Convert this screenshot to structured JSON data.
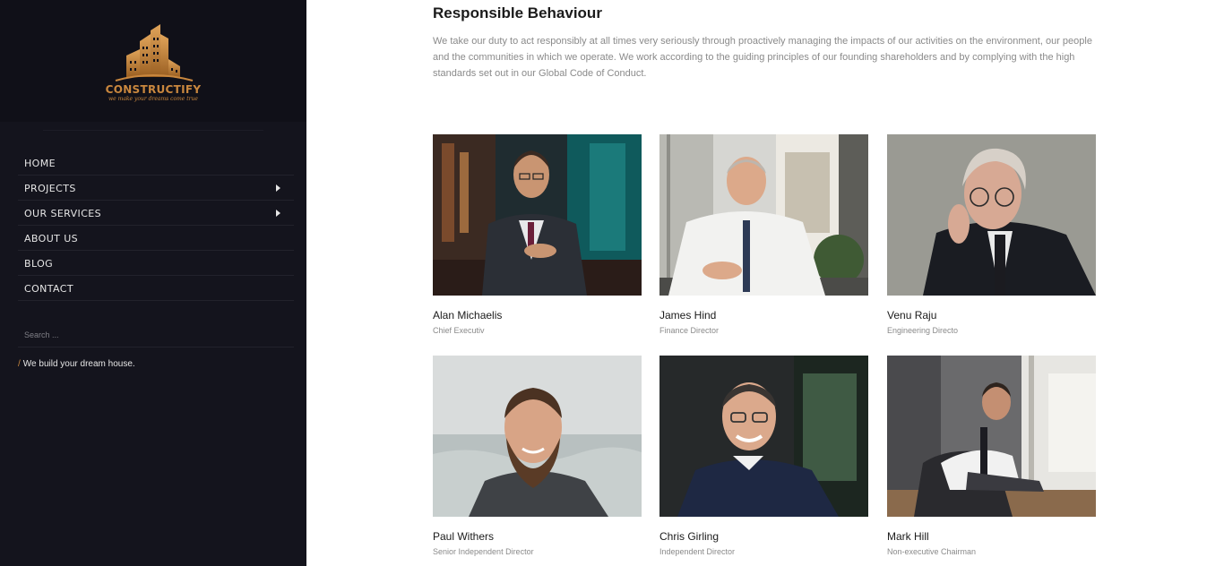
{
  "brand": {
    "name": "CONSTRUCTIFY",
    "tagline": "we make your dreams come true",
    "logo_color": "#c9873e"
  },
  "nav": {
    "items": [
      {
        "label": "HOME",
        "has_submenu": false
      },
      {
        "label": "PROJECTS",
        "has_submenu": true
      },
      {
        "label": "OUR SERVICES",
        "has_submenu": true
      },
      {
        "label": "ABOUT US",
        "has_submenu": false
      },
      {
        "label": "BLOG",
        "has_submenu": false
      },
      {
        "label": "CONTACT",
        "has_submenu": false
      }
    ]
  },
  "search": {
    "placeholder": "Search ...",
    "value": ""
  },
  "sidebar_footer": {
    "slash": "/",
    "text": "We build your dream house."
  },
  "main": {
    "title": "Responsible Behaviour",
    "intro": "We take our duty to act responsibly at all times very seriously through proactively managing the impacts of our activities on the environment, our people and the communities in which we operate. We work according to the guiding principles of our founding shareholders and by complying with the high standards set out in our Global Code of Conduct.",
    "team": [
      {
        "name": "Alan Michaelis",
        "role": "Chief Executiv",
        "photo": "man-in-suit-with-phone-photo"
      },
      {
        "name": "James Hind",
        "role": "Finance Director",
        "photo": "man-at-desk-photo"
      },
      {
        "name": "Venu Raju",
        "role": "Engineering Directo",
        "photo": "man-with-glasses-photo"
      },
      {
        "name": "Paul Withers",
        "role": "Senior Independent Director",
        "photo": "bearded-man-at-beach-photo"
      },
      {
        "name": "Chris Girling",
        "role": "Independent Director",
        "photo": "smiling-man-with-glasses-photo"
      },
      {
        "name": "Mark Hill",
        "role": "Non-executive Chairman",
        "photo": "seated-man-by-window-photo"
      }
    ]
  },
  "colors": {
    "sidebar_bg": "#14141d",
    "accent": "#c9873e",
    "body_text": "#8a8a8a",
    "heading_text": "#1b1b1b"
  }
}
